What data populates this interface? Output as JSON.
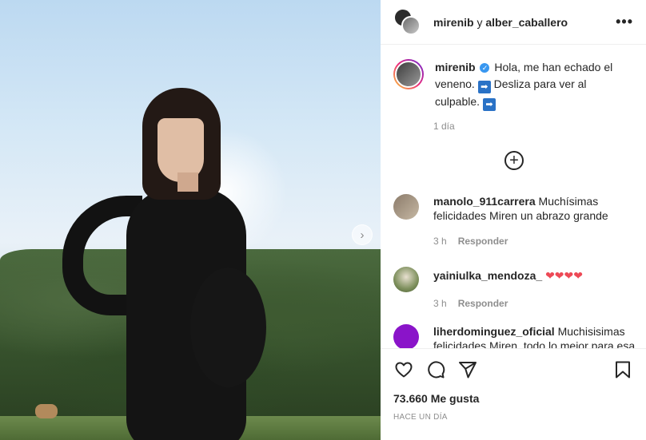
{
  "post": {
    "header": {
      "user1": "mirenib",
      "conj": "y",
      "user2": "alber_caballero",
      "more_label": "•••"
    },
    "caption": {
      "username": "mirenib",
      "text1": "Hola, me han echado el veneno.",
      "arrow": "➡",
      "text2": "Desliza para ver al culpable.",
      "time": "1 día"
    },
    "load_more_label": "+",
    "comments": [
      {
        "username": "manolo_911carrera",
        "text": "Muchísimas felicidades Miren un abrazo grande",
        "time": "3 h",
        "reply": "Responder"
      },
      {
        "username": "yainiulka_mendoza_",
        "text": "❤❤❤❤",
        "time": "3 h",
        "reply": "Responder"
      },
      {
        "username": "liherdominguez_oficial",
        "text": "Muchisisimas felicidades Miren, todo lo mejor para esa nueva etapa"
      }
    ],
    "likes": "73.660 Me gusta",
    "posted": "HACE UN DÍA",
    "next_label": "›"
  },
  "colors": {
    "accent": "#3897f0",
    "heart": "#ed4956",
    "muted": "#8e8e8e"
  }
}
